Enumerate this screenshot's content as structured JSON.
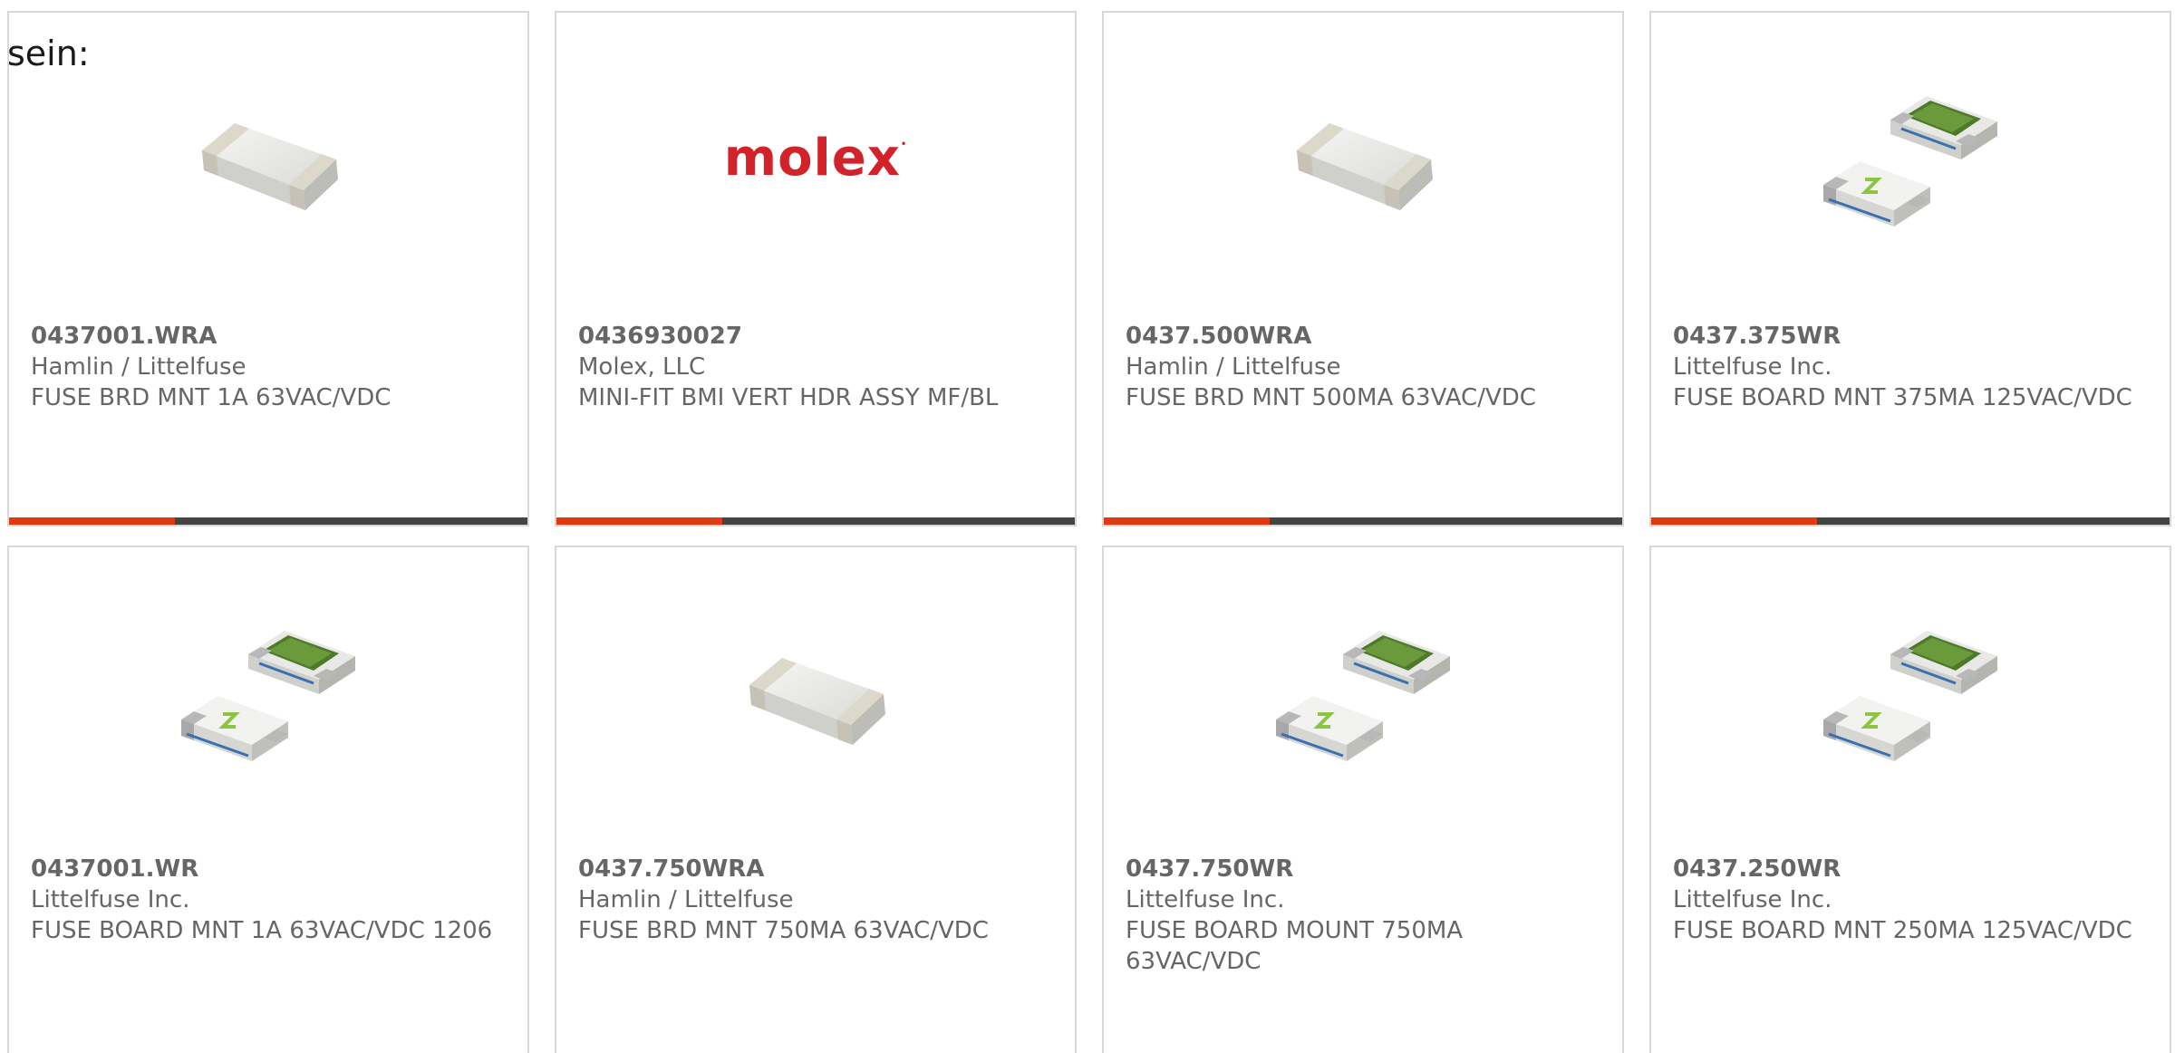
{
  "intro": {
    "text": "sein:"
  },
  "colors": {
    "accent": "#e03a10",
    "bar": "#444444",
    "text": "#666666",
    "border": "#d8d8d8",
    "molex_red": "#d2232a"
  },
  "cards": [
    {
      "part_number": "0437001.WRA",
      "manufacturer": "Hamlin / Littelfuse",
      "description": "FUSE BRD MNT 1A 63VAC/VDC",
      "image": "white-ceramic-fuse-image"
    },
    {
      "part_number": "0436930027",
      "manufacturer": "Molex, LLC",
      "description": "MINI-FIT BMI VERT HDR ASSY MF/BL",
      "image": "molex-logo",
      "logo_text": "molex"
    },
    {
      "part_number": "0437.500WRA",
      "manufacturer": "Hamlin / Littelfuse",
      "description": "FUSE BRD MNT 500MA 63VAC/VDC",
      "image": "white-ceramic-fuse-image"
    },
    {
      "part_number": "0437.375WR",
      "manufacturer": "Littelfuse Inc.",
      "description": "FUSE BOARD MNT 375MA 125VAC/VDC",
      "image": "littelfuse-pair-image"
    },
    {
      "part_number": "0437001.WR",
      "manufacturer": "Littelfuse Inc.",
      "description": "FUSE BOARD MNT 1A 63VAC/VDC 1206",
      "image": "littelfuse-pair-image"
    },
    {
      "part_number": "0437.750WRA",
      "manufacturer": "Hamlin / Littelfuse",
      "description": "FUSE BRD MNT 750MA 63VAC/VDC",
      "image": "white-ceramic-fuse-image"
    },
    {
      "part_number": "0437.750WR",
      "manufacturer": "Littelfuse Inc.",
      "description": "FUSE BOARD MOUNT 750MA 63VAC/VDC",
      "image": "littelfuse-pair-image"
    },
    {
      "part_number": "0437.250WR",
      "manufacturer": "Littelfuse Inc.",
      "description": "FUSE BOARD MNT 250MA 125VAC/VDC",
      "image": "littelfuse-pair-image"
    }
  ]
}
